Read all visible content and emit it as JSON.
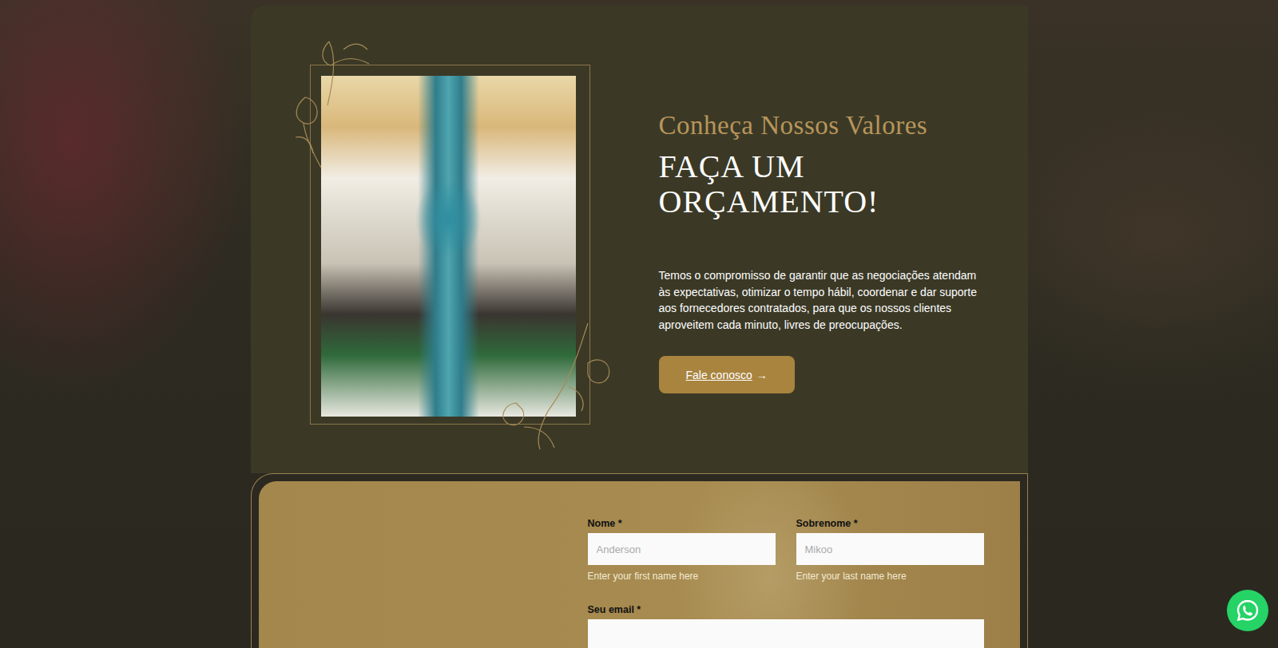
{
  "hero": {
    "eyebrow": "Conheça Nossos Valores",
    "title": "FAÇA UM ORÇAMENTO!",
    "description": "Temos o compromisso de garantir que as negociações atendam às expectativas, otimizar o tempo hábil, coordenar e dar suporte aos fornecedores contratados, para que os nossos clientes aproveitem cada minuto, livres de preocupações.",
    "button": {
      "label": "Fale conosco",
      "icon": "→"
    }
  },
  "form": {
    "fields": [
      {
        "kind": "half",
        "label": "Nome *",
        "placeholder": "Anderson",
        "help": "Enter your first name here"
      },
      {
        "kind": "half",
        "label": "Sobrenome *",
        "placeholder": "Mikoo",
        "help": "Enter your last name here"
      },
      {
        "kind": "wide",
        "label": "Seu email *"
      }
    ]
  }
}
